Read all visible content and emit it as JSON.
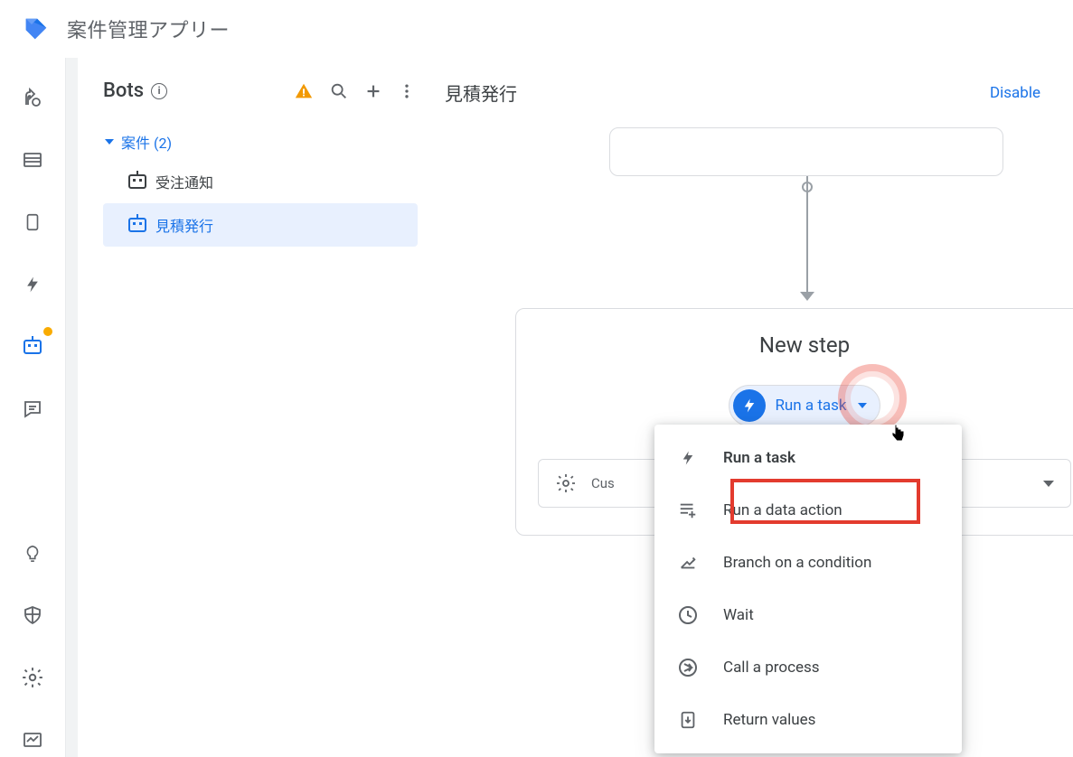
{
  "header": {
    "app_title": "案件管理アプリー"
  },
  "bots_panel": {
    "title": "Bots",
    "tree": {
      "parent_label": "案件 (2)",
      "items": [
        {
          "label": "受注通知",
          "selected": false
        },
        {
          "label": "見積発行",
          "selected": true
        }
      ]
    }
  },
  "main": {
    "title": "見積発行",
    "disable_label": "Disable",
    "new_step": {
      "title": "New step",
      "chip_label": "Run a task",
      "custom_label": "Cus"
    }
  },
  "dropdown": {
    "items": [
      {
        "label": "Run a task",
        "bold": true,
        "icon": "bolt"
      },
      {
        "label": "Run a data action",
        "bold": false,
        "icon": "data-add"
      },
      {
        "label": "Branch on a condition",
        "bold": false,
        "icon": "branch"
      },
      {
        "label": "Wait",
        "bold": false,
        "icon": "clock"
      },
      {
        "label": "Call a process",
        "bold": false,
        "icon": "call"
      },
      {
        "label": "Return values",
        "bold": false,
        "icon": "return"
      }
    ]
  },
  "highlighted_index": 1
}
